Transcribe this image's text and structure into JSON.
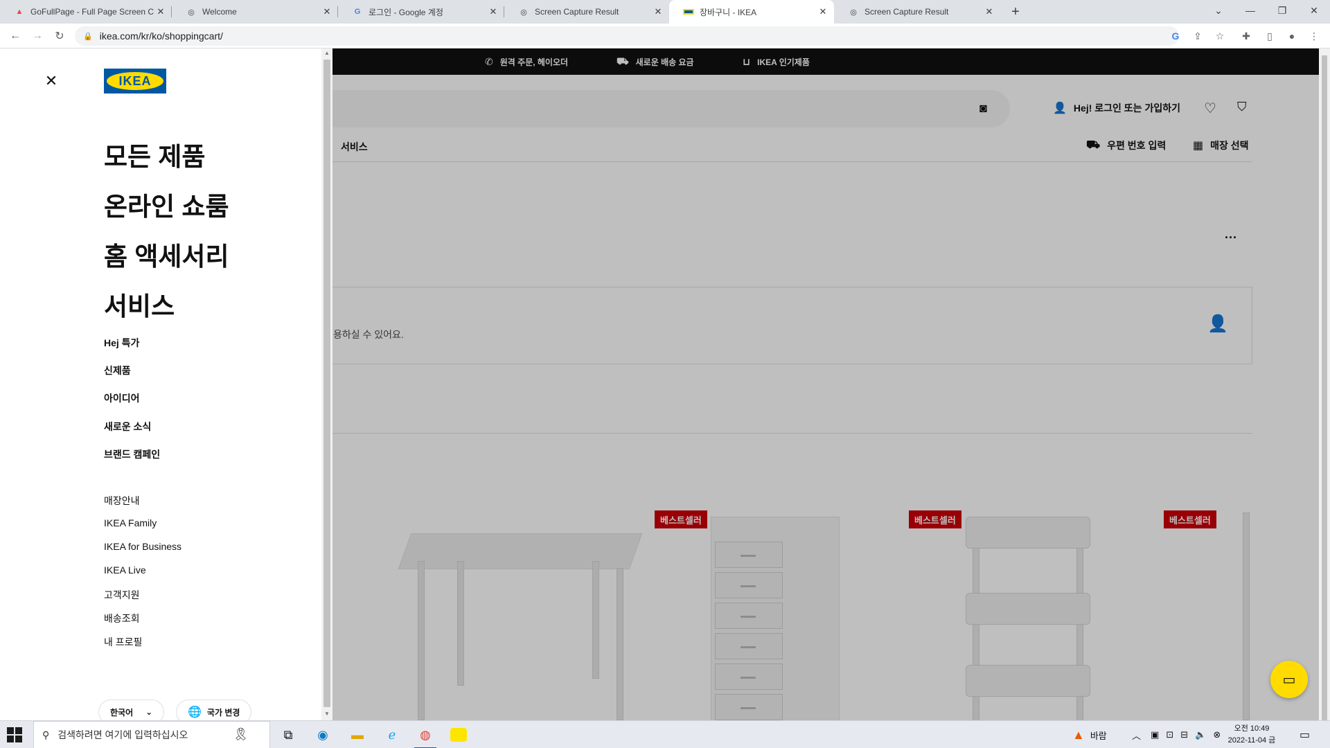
{
  "browser": {
    "tabs": [
      {
        "title": "GoFullPage - Full Page Screen C",
        "icon": "gofullpage-icon",
        "active": false
      },
      {
        "title": "Welcome",
        "icon": "camera-icon",
        "active": false
      },
      {
        "title": "로그인 - Google 계정",
        "icon": "google-icon",
        "active": false
      },
      {
        "title": "Screen Capture Result",
        "icon": "camera-icon",
        "active": false
      },
      {
        "title": "장바구니 - IKEA",
        "icon": "ikea-icon",
        "active": true
      },
      {
        "title": "Screen Capture Result",
        "icon": "camera-icon",
        "active": false
      }
    ],
    "url": "ikea.com/kr/ko/shoppingcart/"
  },
  "menu": {
    "logo_text": "IKEA",
    "primary": [
      "모든 제품",
      "온라인 쇼룸",
      "홈 액세서리",
      "서비스"
    ],
    "secondary": [
      "Hej 특가",
      "신제품",
      "아이디어",
      "새로운 소식",
      "브랜드 캠페인"
    ],
    "tertiary": [
      "매장안내",
      "IKEA Family",
      "IKEA for Business",
      "IKEA Live",
      "고객지원",
      "배송조회",
      "내 프로필"
    ],
    "language_label": "한국어",
    "country_label": "국가 변경"
  },
  "page": {
    "promo": [
      "원격 주문, 헤이오더",
      "새로운 배송 요금",
      "IKEA 인기제품"
    ],
    "login_label": "Hej! 로그인 또는 가입하기",
    "nav_service": "서비스",
    "postal_label": "우편 번호 입력",
    "store_label": "매장 선택",
    "more_label": "...",
    "loginbox_text": "용하실 수 있어요.",
    "badge": "베스트셀러"
  },
  "taskbar": {
    "search_placeholder": "검색하려면 여기에 입력하십시오",
    "weather": "바람",
    "time": "오전 10:49",
    "date": "2022-11-04 금"
  }
}
